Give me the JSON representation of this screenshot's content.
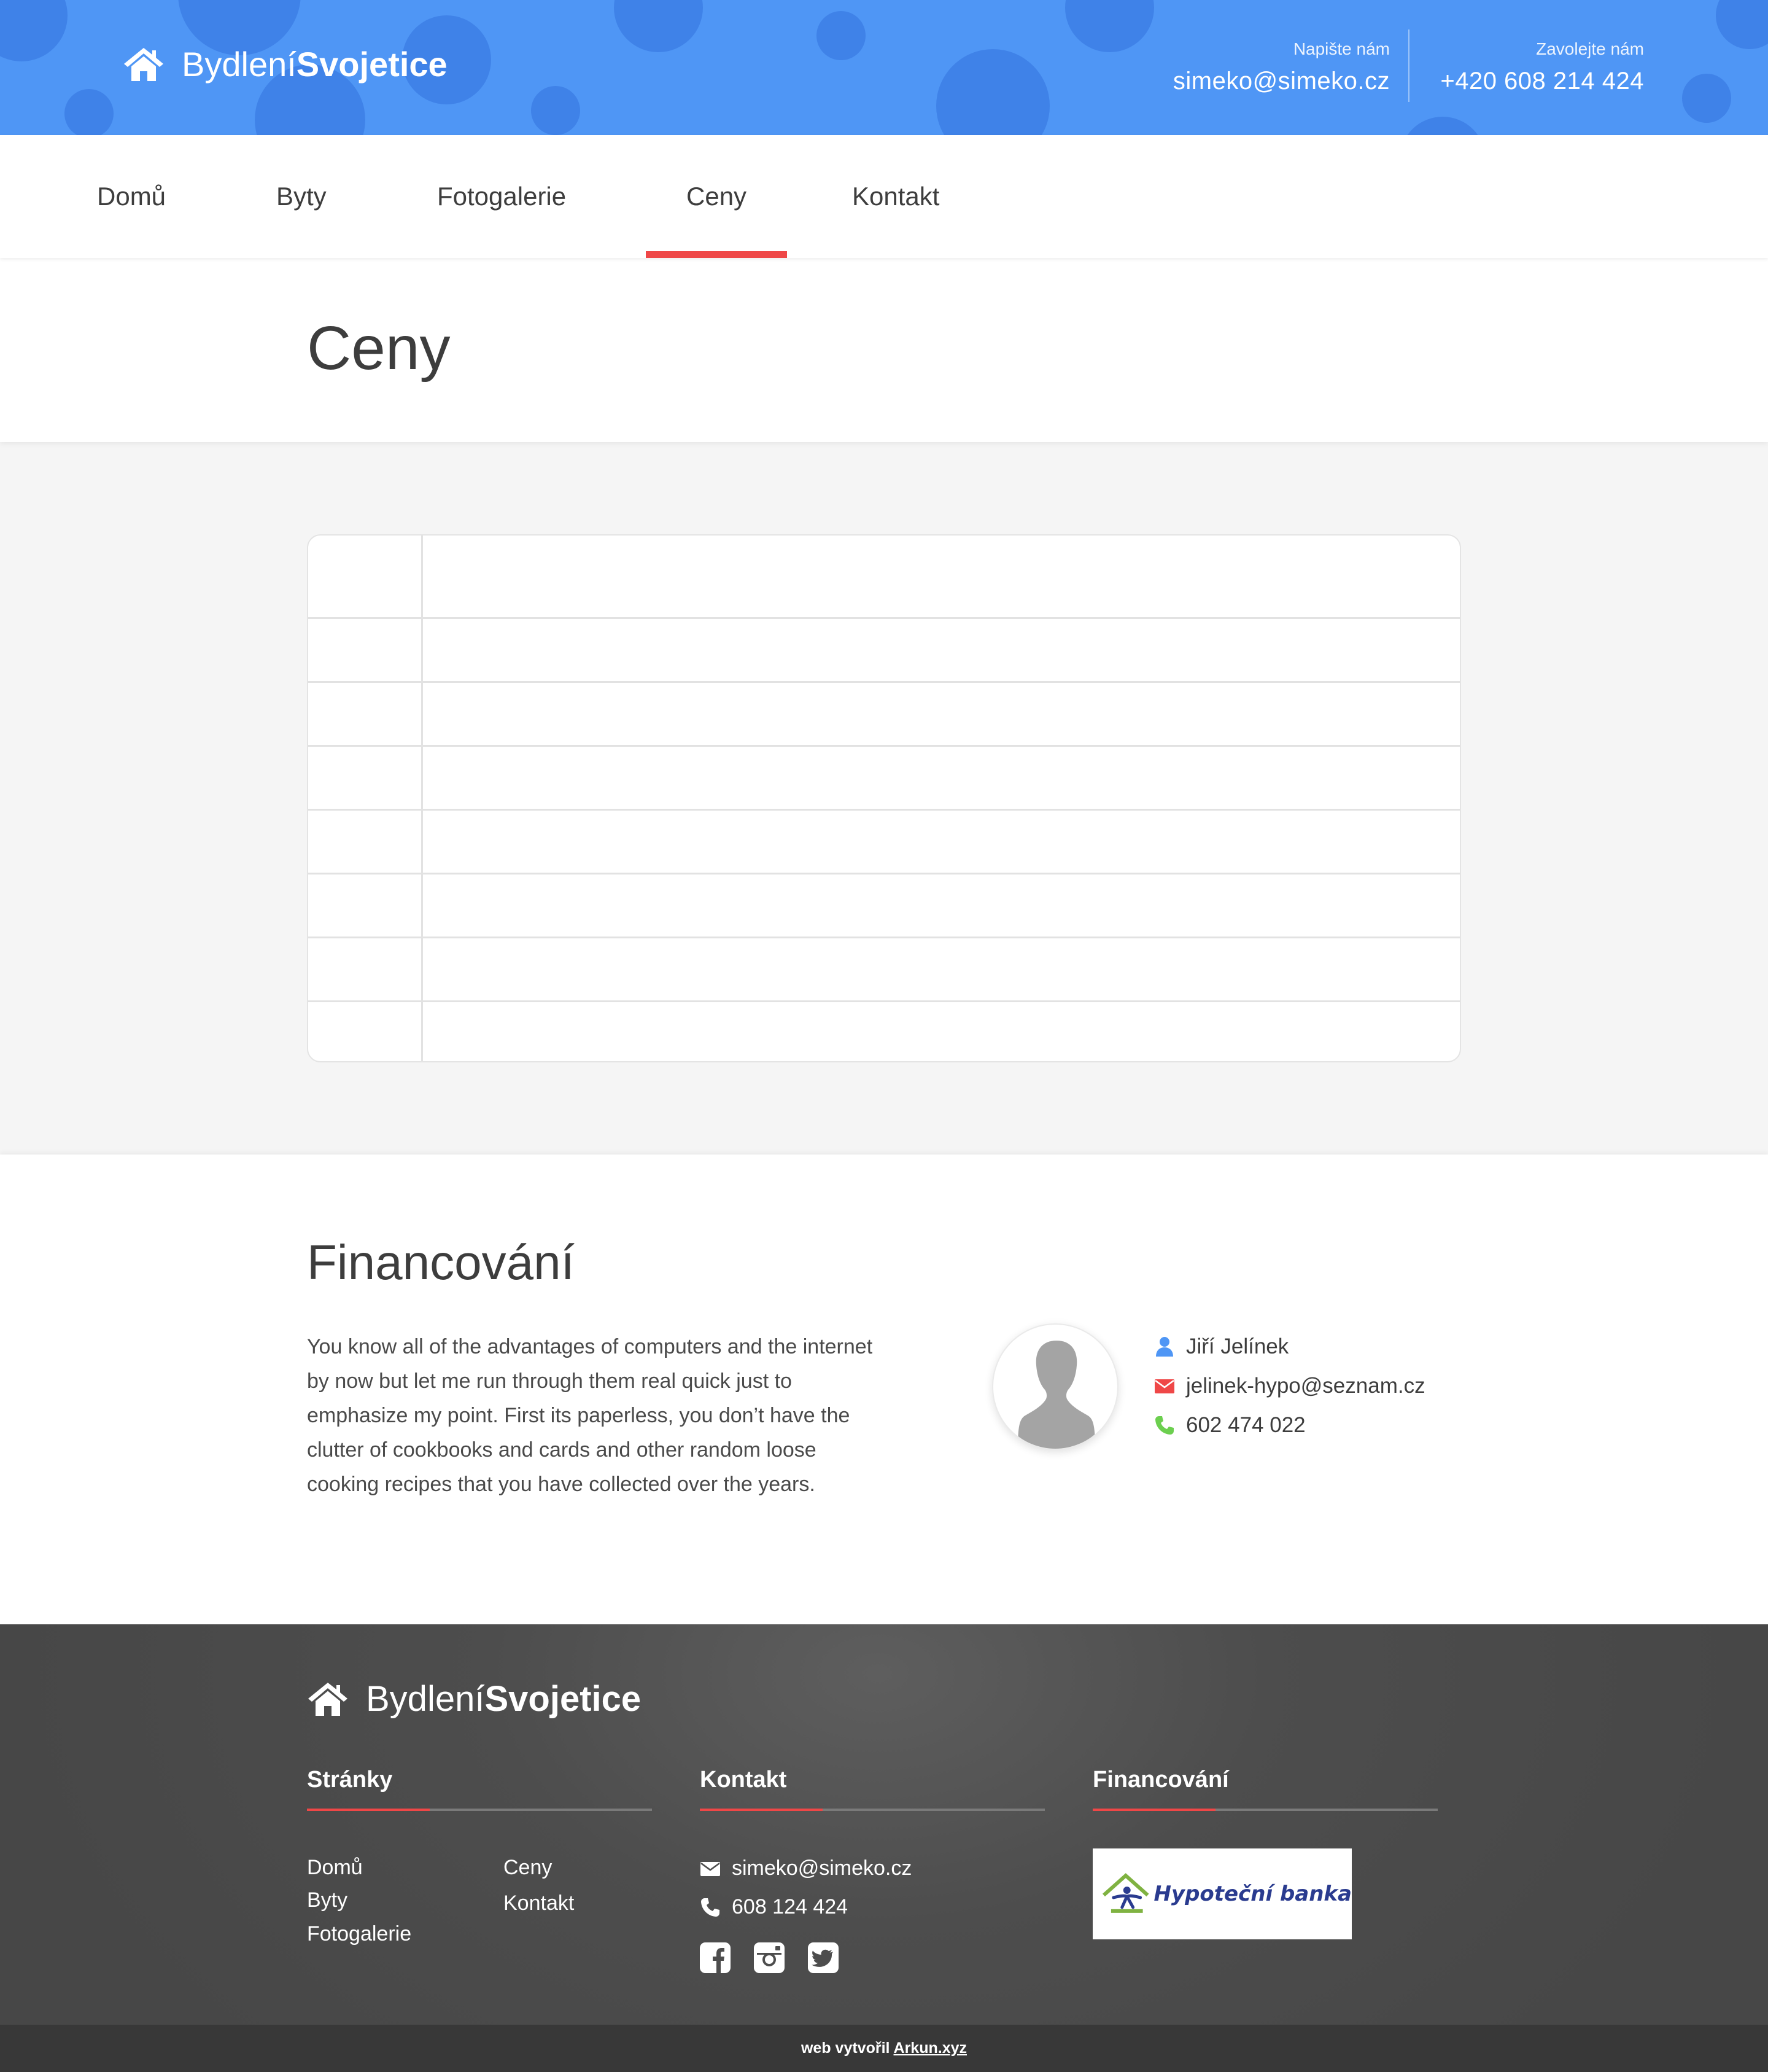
{
  "brand": {
    "name_light": "Bydlení",
    "name_bold": "Svojetice"
  },
  "header": {
    "email_label": "Napište nám",
    "email": "simeko@simeko.cz",
    "phone_label": "Zavolejte nám",
    "phone": "+420 608 214 424"
  },
  "nav": {
    "items": [
      {
        "label": "Domů"
      },
      {
        "label": "Byty"
      },
      {
        "label": "Fotogalerie"
      },
      {
        "label": "Ceny",
        "active": true
      },
      {
        "label": "Kontakt"
      }
    ]
  },
  "page": {
    "title": "Ceny"
  },
  "price_table": {
    "rows": 8,
    "columns": 2
  },
  "financing": {
    "title": "Financování",
    "text": "You know all of the advantages of computers and the internet by now but let me run through them real quick just to emphasize my point. First its paperless, you don’t have the clutter of cookbooks and cards and other random loose cooking recipes that you have collected over the years.",
    "contact": {
      "name": "Jiří Jelínek",
      "email": "jelinek-hypo@seznam.cz",
      "phone": "602 474 022"
    }
  },
  "footer": {
    "pages_title": "Stránky",
    "pages": {
      "col1": [
        "Domů",
        "Byty",
        "Fotogalerie"
      ],
      "col2": [
        "Ceny",
        "Kontakt"
      ]
    },
    "contact_title": "Kontakt",
    "contact_email": "simeko@simeko.cz",
    "contact_phone": "608 124 424",
    "financing_title": "Financování",
    "bank_name": "Hypoteční banka"
  },
  "bottom": {
    "prefix": "web vytvořil",
    "link": "Arkun.xyz"
  },
  "colors": {
    "header_blue": "#4f96f5",
    "accent_red": "#ef4747",
    "icon_blue": "#4f96f5",
    "icon_red": "#ef4747",
    "icon_green": "#6ccf4f",
    "footer_gray": "#4d4d4d"
  },
  "icons": [
    "home-icon",
    "user-icon",
    "envelope-icon",
    "phone-icon",
    "facebook-icon",
    "instagram-icon",
    "twitter-icon"
  ]
}
